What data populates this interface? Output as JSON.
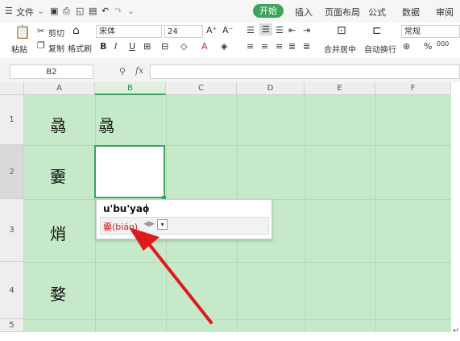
{
  "menubar": {
    "file_label": "文件",
    "tabs": [
      {
        "label": "开始",
        "active": true
      },
      {
        "label": "插入"
      },
      {
        "label": "页面布局"
      },
      {
        "label": "公式"
      },
      {
        "label": "数据"
      },
      {
        "label": "审阅"
      }
    ]
  },
  "ribbon": {
    "paste": "粘贴",
    "cut": "剪切",
    "copy": "复制",
    "format_painter": "格式刷",
    "font_name": "宋体",
    "font_size": "24",
    "bold": "B",
    "italic": "I",
    "underline": "U",
    "merge_center": "合并居中",
    "wrap_text": "自动换行",
    "number_format": "常规",
    "percent": "%",
    "thousands": "000"
  },
  "formula_bar": {
    "name_box": "B2",
    "fx": "fx",
    "content": ""
  },
  "grid": {
    "columns": [
      "A",
      "B",
      "C",
      "D",
      "E",
      "F"
    ],
    "rows": [
      "1",
      "2",
      "3",
      "4",
      "5"
    ],
    "cells": {
      "A1": "骉",
      "B1": "骉",
      "A2": "嫑",
      "A3": "焇",
      "A4": "婺"
    }
  },
  "ime": {
    "input": "u'bu'yao",
    "candidate_char": "嫑",
    "candidate_pinyin": "(biáo)"
  },
  "colors": {
    "sheet_bg": "#c6e9c9",
    "accent": "#3aa55d",
    "arrow": "#e0191b"
  }
}
